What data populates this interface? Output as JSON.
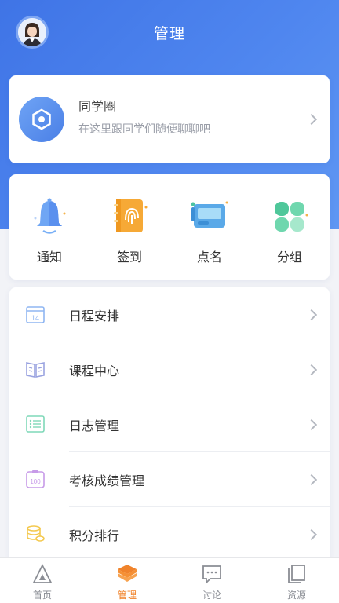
{
  "header": {
    "title": "管理"
  },
  "circle": {
    "title": "同学圈",
    "subtitle": "在这里跟同学们随便聊聊吧"
  },
  "quick_actions": [
    {
      "label": "通知",
      "icon": "bell-icon"
    },
    {
      "label": "签到",
      "icon": "fingerprint-icon"
    },
    {
      "label": "点名",
      "icon": "roll-call-icon"
    },
    {
      "label": "分组",
      "icon": "group-icon"
    }
  ],
  "menu": [
    {
      "label": "日程安排",
      "icon": "calendar-icon",
      "icon_text": "14"
    },
    {
      "label": "课程中心",
      "icon": "book-icon"
    },
    {
      "label": "日志管理",
      "icon": "list-icon"
    },
    {
      "label": "考核成绩管理",
      "icon": "score-icon",
      "icon_text": "100"
    },
    {
      "label": "积分排行",
      "icon": "coins-icon"
    }
  ],
  "tabs": [
    {
      "label": "首页",
      "icon": "home-icon",
      "active": false
    },
    {
      "label": "管理",
      "icon": "layers-icon",
      "active": true
    },
    {
      "label": "讨论",
      "icon": "chat-icon",
      "active": false
    },
    {
      "label": "资源",
      "icon": "files-icon",
      "active": false
    }
  ],
  "colors": {
    "primary": "#4a80eb",
    "active_tab": "#f0832b",
    "background": "#f2f3f7"
  }
}
